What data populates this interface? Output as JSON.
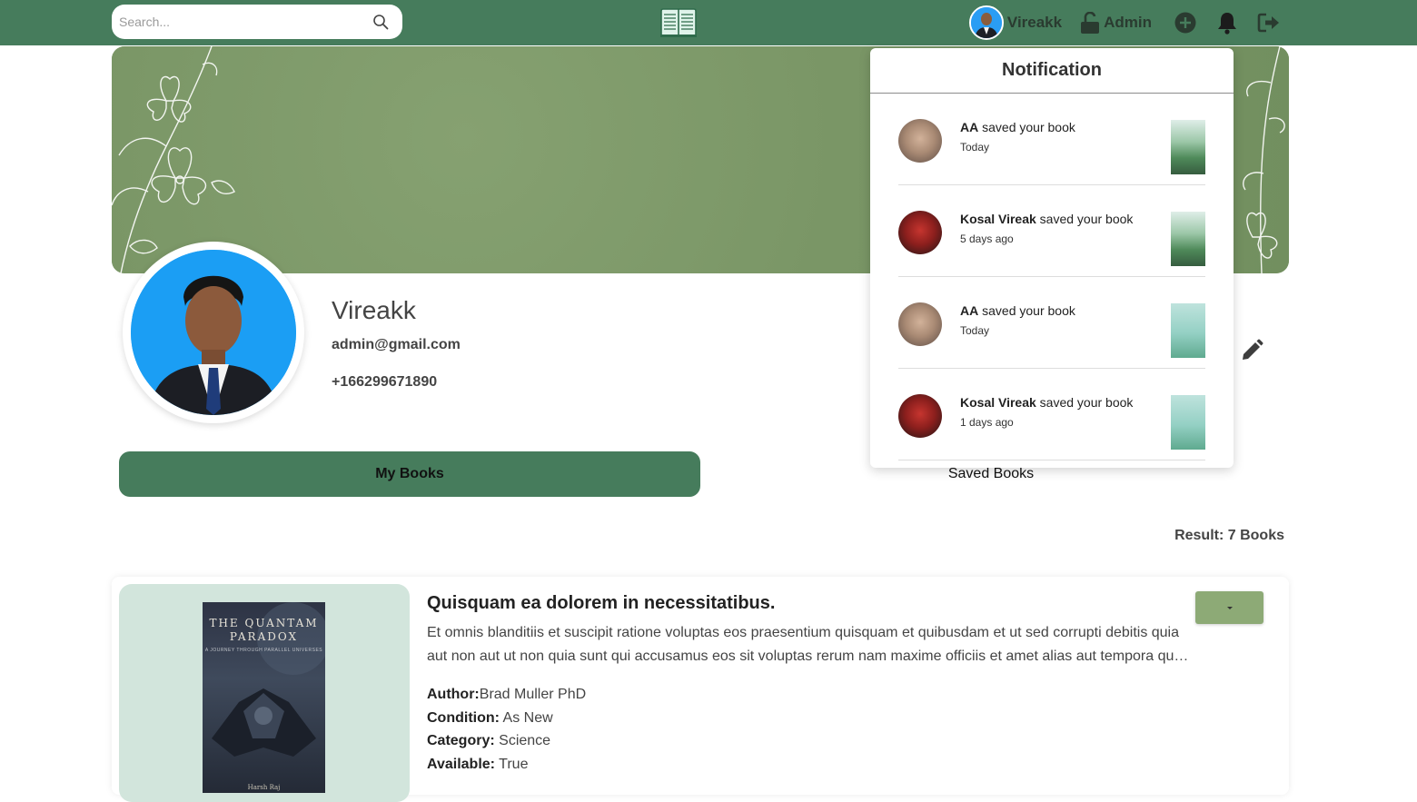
{
  "navbar": {
    "search_placeholder": "Search...",
    "user_name": "Vireakk",
    "admin_label": "Admin"
  },
  "profile": {
    "name": "Vireakk",
    "email": "admin@gmail.com",
    "phone": "+166299671890"
  },
  "tabs": {
    "my_books": "My Books",
    "saved_books": "Saved Books"
  },
  "result": "Result: 7 Books",
  "book": {
    "title": "Quisquam ea dolorem in necessitatibus.",
    "description": "Et omnis blanditiis et suscipit ratione voluptas eos praesentium quisquam et quibusdam et ut sed corrupti debitis quia aut non aut ut non quia sunt qui accusamus eos sit voluptas rerum nam maxime officiis et amet alias aut tempora quo ea omnis.",
    "cover_title": "THE QUANTAM PARADOX",
    "cover_subtitle": "A JOURNEY THROUGH PARALLEL UNIVERSES",
    "cover_author": "Harsh Raj",
    "author_label": "Author:",
    "author": "Brad Muller PhD",
    "condition_label": "Condition:",
    "condition": "As New",
    "category_label": "Category:",
    "category": "Science",
    "available_label": "Available:",
    "available": "True"
  },
  "notifications": {
    "title": "Notification",
    "items": [
      {
        "name": "AA",
        "action": " saved your book",
        "time": "Today"
      },
      {
        "name": "Kosal Vireak",
        "action": " saved your book",
        "time": "5 days ago"
      },
      {
        "name": "AA",
        "action": " saved your book",
        "time": "Today"
      },
      {
        "name": "Kosal Vireak",
        "action": " saved your book",
        "time": "1 days ago"
      }
    ]
  },
  "colors": {
    "primary": "#467c5c",
    "banner": "#7e9a6a",
    "dropdown_button": "#8daa76",
    "card_image_bg": "#d2e5dc"
  }
}
